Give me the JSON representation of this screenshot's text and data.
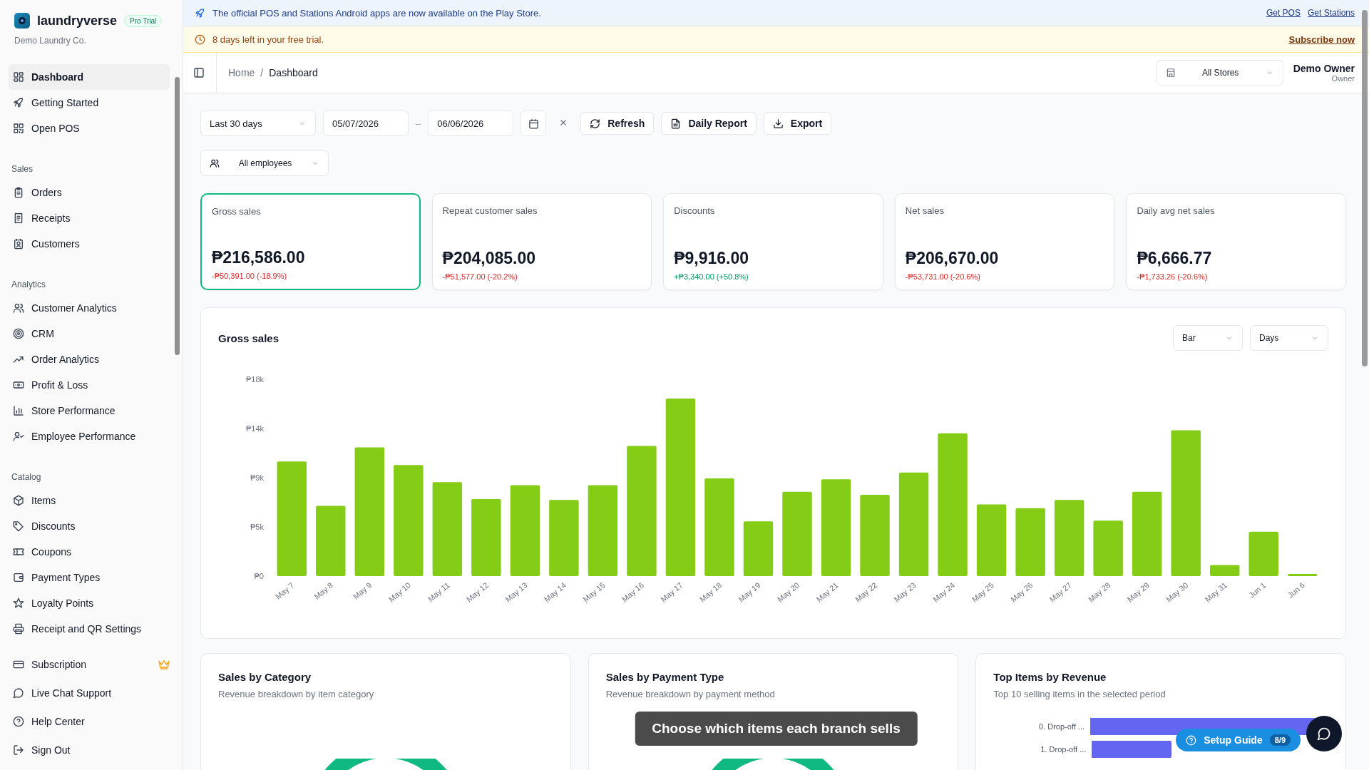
{
  "announcement": {
    "text": "The official POS and Stations Android apps are now available on the Play Store.",
    "links": [
      "Get POS",
      "Get Stations"
    ]
  },
  "trial_banner": {
    "text": "8 days left in your free trial.",
    "link": "Subscribe now"
  },
  "sidebar": {
    "brand": "laundryverse",
    "badge": "Pro Trial",
    "org": "Demo Laundry Co.",
    "sections": [
      {
        "items": [
          {
            "label": "Dashboard",
            "selected": true
          },
          {
            "label": "Getting Started",
            "selected": false
          },
          {
            "label": "Open POS",
            "selected": false
          }
        ]
      },
      {
        "heading": "Sales",
        "items": [
          {
            "label": "Orders",
            "selected": false
          },
          {
            "label": "Receipts",
            "selected": false
          },
          {
            "label": "Customers",
            "selected": false
          }
        ]
      },
      {
        "heading": "Analytics",
        "items": [
          {
            "label": "Customer Analytics",
            "selected": false
          },
          {
            "label": "CRM",
            "selected": false
          },
          {
            "label": "Order Analytics",
            "selected": false
          },
          {
            "label": "Profit & Loss",
            "selected": false
          },
          {
            "label": "Store Performance",
            "selected": false
          },
          {
            "label": "Employee Performance",
            "selected": false
          }
        ]
      },
      {
        "heading": "Catalog",
        "items": [
          {
            "label": "Items",
            "selected": false
          },
          {
            "label": "Discounts",
            "selected": false
          },
          {
            "label": "Coupons",
            "selected": false
          },
          {
            "label": "Payment Types",
            "selected": false
          },
          {
            "label": "Loyalty Points",
            "selected": false
          },
          {
            "label": "Receipt and QR Settings",
            "selected": false
          }
        ]
      }
    ],
    "footer_items": [
      {
        "label": "Subscription",
        "premium": true
      },
      {
        "label": "Live Chat Support",
        "premium": false
      },
      {
        "label": "Help Center",
        "premium": false
      },
      {
        "label": "Sign Out",
        "premium": false
      }
    ]
  },
  "header": {
    "breadcrumb": [
      "Home",
      "Dashboard"
    ],
    "breadcrumb_separator": "/",
    "store_select": "All Stores",
    "user": {
      "name": "Demo Owner",
      "role": "Owner"
    }
  },
  "filters": {
    "range": "Last 30 days",
    "start": "05/07/2026",
    "separator": "–",
    "end": "06/06/2026",
    "buttons": [
      "Refresh",
      "Daily Report",
      "Export"
    ],
    "employees": "All employees"
  },
  "metrics": [
    {
      "label": "Gross sales",
      "value": "₱216,586.00",
      "change": "-₱50,391.00 (-18.9%)",
      "positive": false,
      "selected": true
    },
    {
      "label": "Repeat customer sales",
      "value": "₱204,085.00",
      "change": "-₱51,577.00 (-20.2%)",
      "positive": false,
      "selected": false
    },
    {
      "label": "Discounts",
      "value": "₱9,916.00",
      "change": "+₱3,340.00 (+50.8%)",
      "positive": true,
      "selected": false
    },
    {
      "label": "Net sales",
      "value": "₱206,670.00",
      "change": "-₱53,731.00 (-20.6%)",
      "positive": false,
      "selected": false
    },
    {
      "label": "Daily avg net sales",
      "value": "₱6,666.77",
      "change": "-₱1,733.26 (-20.6%)",
      "positive": false,
      "selected": false
    }
  ],
  "sales_chart": {
    "title": "Gross sales",
    "chart_type_select": "Bar",
    "period_select": "Days",
    "chart_data": {
      "type": "bar",
      "categories": [
        "May 7",
        "May 8",
        "May 9",
        "May 10",
        "May 11",
        "May 12",
        "May 13",
        "May 14",
        "May 15",
        "May 16",
        "May 17",
        "May 18",
        "May 19",
        "May 20",
        "May 21",
        "May 22",
        "May 23",
        "May 24",
        "May 25",
        "May 26",
        "May 27",
        "May 28",
        "May 29",
        "May 30",
        "May 31",
        "Jun 1",
        "Jun 6"
      ],
      "series": [
        {
          "color": "#84cc16",
          "values": [
            10490,
            6430,
            11770,
            10150,
            8590,
            7040,
            8320,
            6970,
            8320,
            11910,
            16240,
            8930,
            5010,
            7710,
            8860,
            7440,
            9470,
            13060,
            6560,
            6220,
            6970,
            5070,
            7710,
            13330,
            1010,
            4060,
            200
          ]
        }
      ],
      "ylim": [
        0,
        18000
      ],
      "yticks": [
        {
          "value": 0,
          "label": "₱0"
        },
        {
          "value": 4500,
          "label": "₱5k"
        },
        {
          "value": 9000,
          "label": "₱9k"
        },
        {
          "value": 13500,
          "label": "₱14k"
        },
        {
          "value": 18000,
          "label": "₱18k"
        }
      ]
    }
  },
  "panels": [
    {
      "title": "Sales by Category",
      "subtitle": "Revenue breakdown by item category",
      "kind": "donut"
    },
    {
      "title": "Sales by Payment Type",
      "subtitle": "Revenue breakdown by payment method",
      "kind": "donut"
    },
    {
      "title": "Top Items by Revenue",
      "subtitle": "Top 10 selling items in the selected period",
      "kind": "bars",
      "items": [
        "0. Drop-off ...",
        "1. Drop-off ..."
      ]
    }
  ],
  "toast": "Choose which items each branch sells",
  "setup_guide": {
    "label": "Setup Guide",
    "progress": "8/9"
  }
}
